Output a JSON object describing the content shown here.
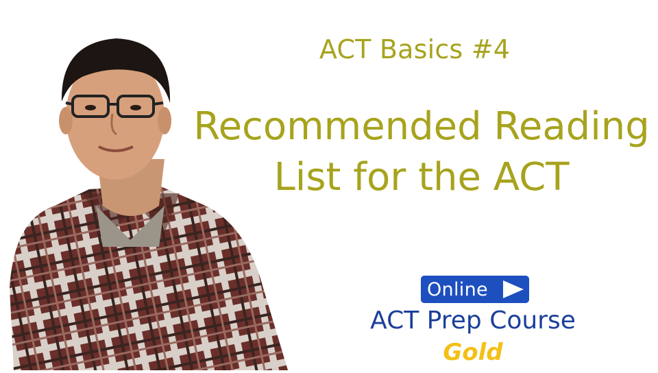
{
  "slide": {
    "subtitle": "ACT Basics #4",
    "title_line1": "Recommended Reading",
    "title_line2": "List for the ACT"
  },
  "brand": {
    "badge_label": "Online",
    "course_name": "ACT Prep Course",
    "tier": "Gold"
  },
  "colors": {
    "title": "#a7a31d",
    "brand_blue": "#1b3f9a",
    "badge_blue": "#1e4fbf",
    "gold": "#f3c018"
  }
}
